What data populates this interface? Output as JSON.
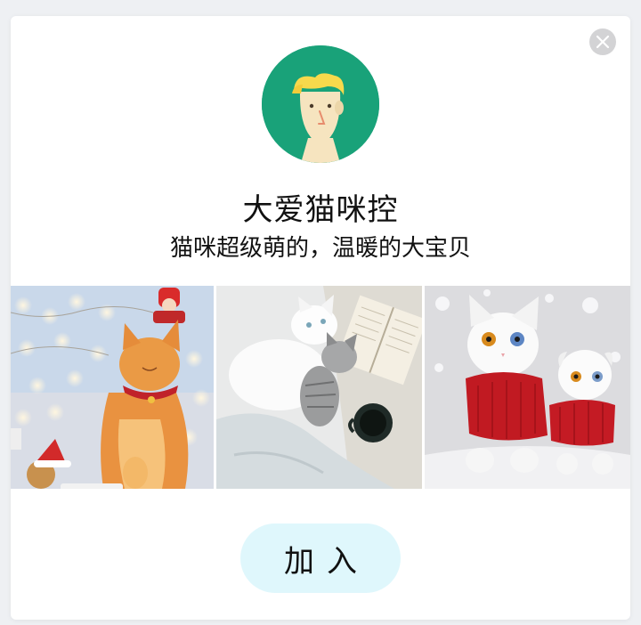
{
  "group": {
    "title": "大爱猫咪控",
    "description": "猫咪超级萌的，温暖的大宝贝"
  },
  "avatar": {
    "icon": "cartoon-man-avatar-icon",
    "background": "#19a279"
  },
  "close": {
    "icon": "close-icon"
  },
  "photos": [
    {
      "name": "photo-orange-cat"
    },
    {
      "name": "photo-white-and-tabby-cats"
    },
    {
      "name": "photo-white-cats-red-sweaters"
    }
  ],
  "join_button": {
    "label": "加入",
    "background": "#dff7fc"
  }
}
